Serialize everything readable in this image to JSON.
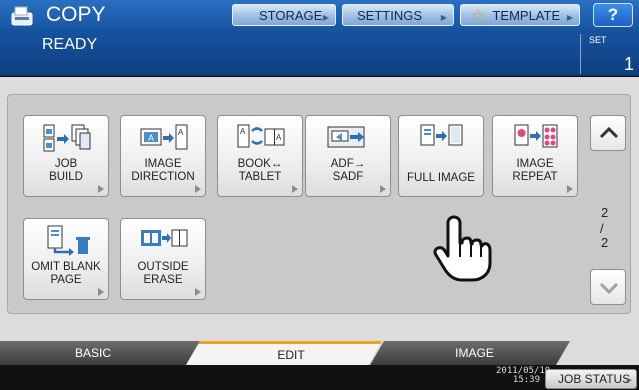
{
  "header": {
    "title": "COPY",
    "status": "READY",
    "set_label": "SET",
    "set_count": "1",
    "buttons": {
      "storage": "STORAGE",
      "settings": "SETTINGS",
      "template": "TEMPLATE",
      "help": "?"
    }
  },
  "functions": [
    {
      "line1": "JOB",
      "line2": "BUILD",
      "icon": "job-build-icon"
    },
    {
      "line1": "IMAGE",
      "line2": "DIRECTION",
      "icon": "image-direction-icon"
    },
    {
      "line1": "BOOK↔",
      "line2": "TABLET",
      "icon": "book-tablet-icon"
    },
    {
      "line1": "ADF→",
      "line2": "SADF",
      "icon": "adf-sadf-icon"
    },
    {
      "line1": "FULL IMAGE",
      "line2": "",
      "icon": "full-image-icon"
    },
    {
      "line1": "IMAGE",
      "line2": "REPEAT",
      "icon": "image-repeat-icon"
    },
    {
      "line1": "OMIT BLANK",
      "line2": "PAGE",
      "icon": "omit-blank-page-icon"
    },
    {
      "line1": "OUTSIDE",
      "line2": "ERASE",
      "icon": "outside-erase-icon"
    }
  ],
  "pager": {
    "current": "2",
    "separator": "/",
    "total": "2"
  },
  "tabs": {
    "basic": "BASIC",
    "edit": "EDIT",
    "image": "IMAGE",
    "active": "EDIT"
  },
  "footer": {
    "date": "2011/05/10",
    "time": "15:39",
    "job_status": "JOB STATUS"
  },
  "colors": {
    "header_blue": "#1a5fb0",
    "active_tab_accent": "#f0a020",
    "panel_gray": "#c9c9c9"
  }
}
